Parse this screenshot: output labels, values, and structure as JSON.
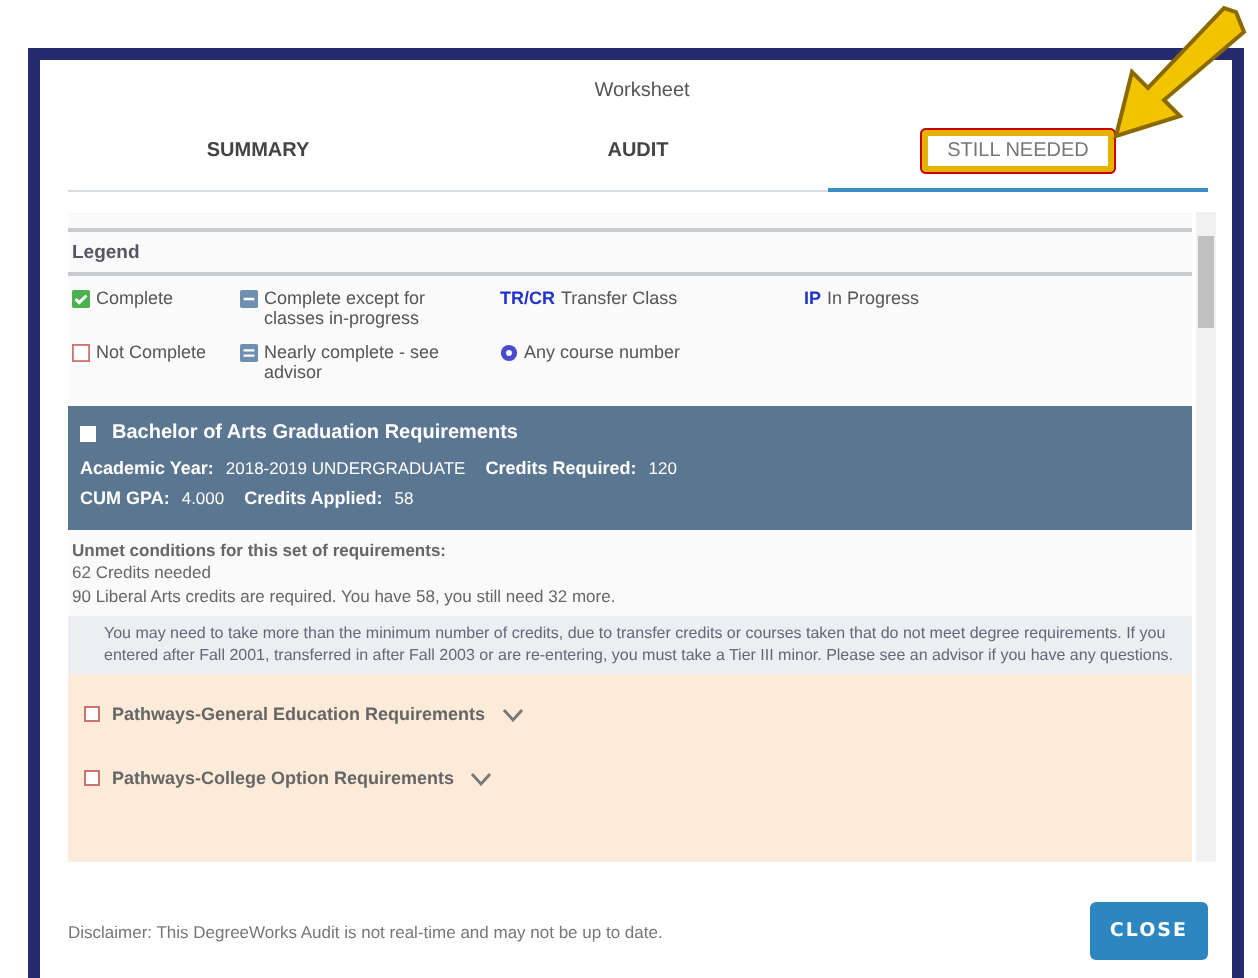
{
  "dialog": {
    "title": "Worksheet"
  },
  "tabs": [
    {
      "label": "SUMMARY",
      "selected": false
    },
    {
      "label": "AUDIT",
      "selected": false
    },
    {
      "label": "STILL NEEDED",
      "selected": true,
      "highlighted": true
    }
  ],
  "legend": {
    "title": "Legend",
    "items": [
      {
        "kind": "complete",
        "label": "Complete"
      },
      {
        "kind": "except",
        "label": "Complete except for classes in-progress"
      },
      {
        "kind": "code",
        "code": "TR/CR",
        "label": "Transfer Class"
      },
      {
        "kind": "code",
        "code": "IP",
        "label": "In Progress"
      },
      {
        "kind": "not-complete",
        "label": "Not Complete"
      },
      {
        "kind": "nearly",
        "label": "Nearly complete - see advisor"
      },
      {
        "kind": "any",
        "label": "Any course number"
      }
    ]
  },
  "requirement_block": {
    "title": "Bachelor of Arts Graduation Requirements",
    "checked": false,
    "fields": [
      [
        {
          "label": "Academic Year:",
          "value": "2018-2019 UNDERGRADUATE"
        },
        {
          "label": "Credits Required:",
          "value": "120"
        }
      ],
      [
        {
          "label": "CUM GPA:",
          "value": "4.000"
        },
        {
          "label": "Credits Applied:",
          "value": "58"
        }
      ]
    ],
    "unmet_title": "Unmet conditions for this set of requirements:",
    "unmet_lines": [
      "62 Credits needed",
      "90 Liberal Arts credits are required. You have 58,  you still need 32 more."
    ],
    "note": "You may need to take more than the minimum  number of credits, due to transfer credits or courses  taken that do not meet degree requirements.  If you entered after Fall 2001, transferred in after Fall 2003 or  are re-entering, you must take a Tier III minor.  Please see an advisor if you have any questions."
  },
  "sections": [
    {
      "title": "Pathways-General Education Requirements",
      "checked": false,
      "expanded": false
    },
    {
      "title": "Pathways-College Option Requirements",
      "checked": false,
      "expanded": false
    }
  ],
  "footer": {
    "disclaimer": "Disclaimer: This DegreeWorks Audit is not real-time and may not be up to date.",
    "button": "CLOSE"
  }
}
